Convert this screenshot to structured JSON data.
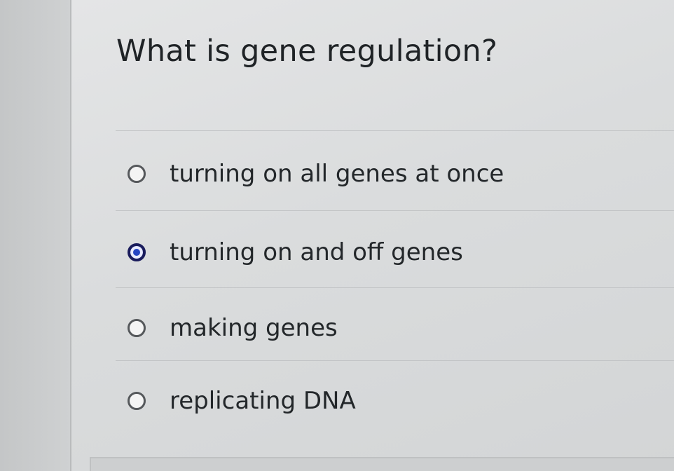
{
  "question": {
    "text": "What is gene regulation?"
  },
  "options": [
    {
      "label": "turning on all genes at once",
      "selected": false
    },
    {
      "label": "turning on and off genes",
      "selected": true
    },
    {
      "label": "making genes",
      "selected": false
    },
    {
      "label": "replicating DNA",
      "selected": false
    }
  ],
  "colors": {
    "selected_radio": "#2545c4",
    "text": "#23272a"
  }
}
